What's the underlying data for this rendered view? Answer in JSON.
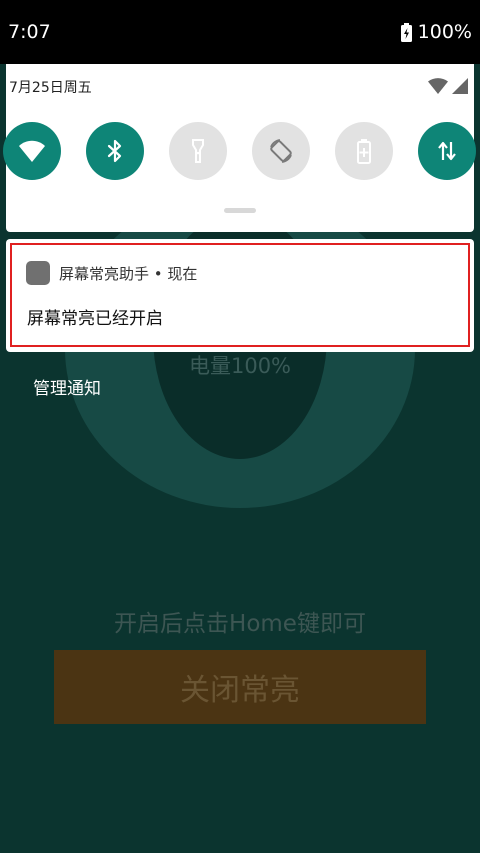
{
  "status_bar": {
    "time": "7:07",
    "battery": "100%"
  },
  "quick_settings": {
    "date": "7月25日周五",
    "tiles": [
      {
        "name": "wifi",
        "icon": "wifi-icon",
        "state": "on"
      },
      {
        "name": "bluetooth",
        "icon": "bluetooth-icon",
        "state": "on"
      },
      {
        "name": "flashlight",
        "icon": "flashlight-icon",
        "state": "off"
      },
      {
        "name": "auto-rotate",
        "icon": "rotate-icon",
        "state": "off"
      },
      {
        "name": "battery-saver",
        "icon": "battery-saver-icon",
        "state": "off"
      },
      {
        "name": "mobile-data",
        "icon": "data-arrows-icon",
        "state": "on"
      }
    ],
    "colors": {
      "tile_on": "#0e8577",
      "tile_off": "#e2e2e2"
    }
  },
  "notification": {
    "header": "屏幕常亮助手 • 现在",
    "body": "屏幕常亮已经开启"
  },
  "background_app": {
    "battery_level": "电量100%",
    "manage_notifications": "管理通知",
    "hint": "开启后点击Home键即可",
    "close_button": "关闭常亮"
  },
  "colors": {
    "accent": "#0e8577",
    "highlight_border": "#e02020",
    "background": "#0b342f",
    "button": "#4b3413"
  }
}
